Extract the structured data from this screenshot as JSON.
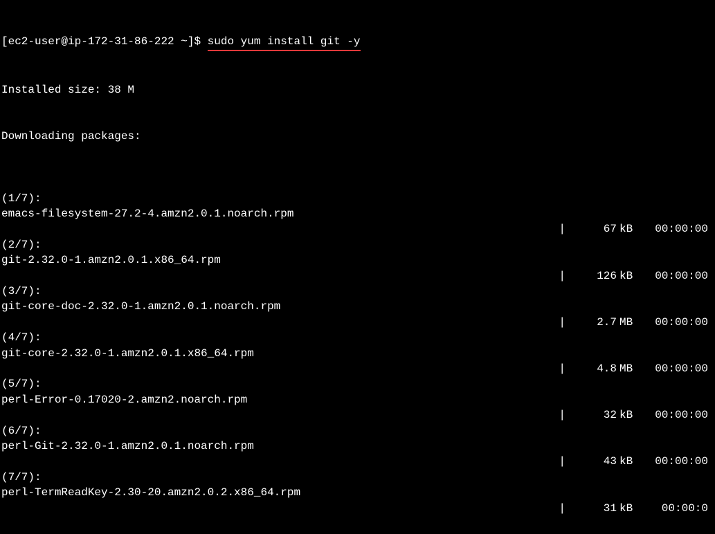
{
  "prompt": {
    "user_host": "[ec2-user@ip-172-31-86-222 ~]$ ",
    "command": "sudo yum install git -y"
  },
  "header": {
    "installed_size": "Installed size: 38 M",
    "downloading": "Downloading packages:"
  },
  "packages": [
    {
      "counter": "(1/7):",
      "filename": "emacs-filesystem-27.2-4.amzn2.0.1.noarch.rpm",
      "size": "67",
      "unit": "kB",
      "time": "00:00:00"
    },
    {
      "counter": "(2/7):",
      "filename": "git-2.32.0-1.amzn2.0.1.x86_64.rpm",
      "size": "126",
      "unit": "kB",
      "time": "00:00:00"
    },
    {
      "counter": "(3/7):",
      "filename": "git-core-doc-2.32.0-1.amzn2.0.1.noarch.rpm",
      "size": "2.7",
      "unit": "MB",
      "time": "00:00:00"
    },
    {
      "counter": "(4/7):",
      "filename": "git-core-2.32.0-1.amzn2.0.1.x86_64.rpm",
      "size": "4.8",
      "unit": "MB",
      "time": "00:00:00"
    },
    {
      "counter": "(5/7):",
      "filename": "perl-Error-0.17020-2.amzn2.noarch.rpm",
      "size": "32",
      "unit": "kB",
      "time": "00:00:00"
    },
    {
      "counter": "(6/7):",
      "filename": "perl-Git-2.32.0-1.amzn2.0.1.noarch.rpm",
      "size": "43",
      "unit": "kB",
      "time": "00:00:00"
    },
    {
      "counter": "(7/7):",
      "filename": "perl-TermReadKey-2.30-20.amzn2.0.2.x86_64.rpm",
      "size": "31",
      "unit": "kB",
      "time": "00:00:0"
    }
  ]
}
